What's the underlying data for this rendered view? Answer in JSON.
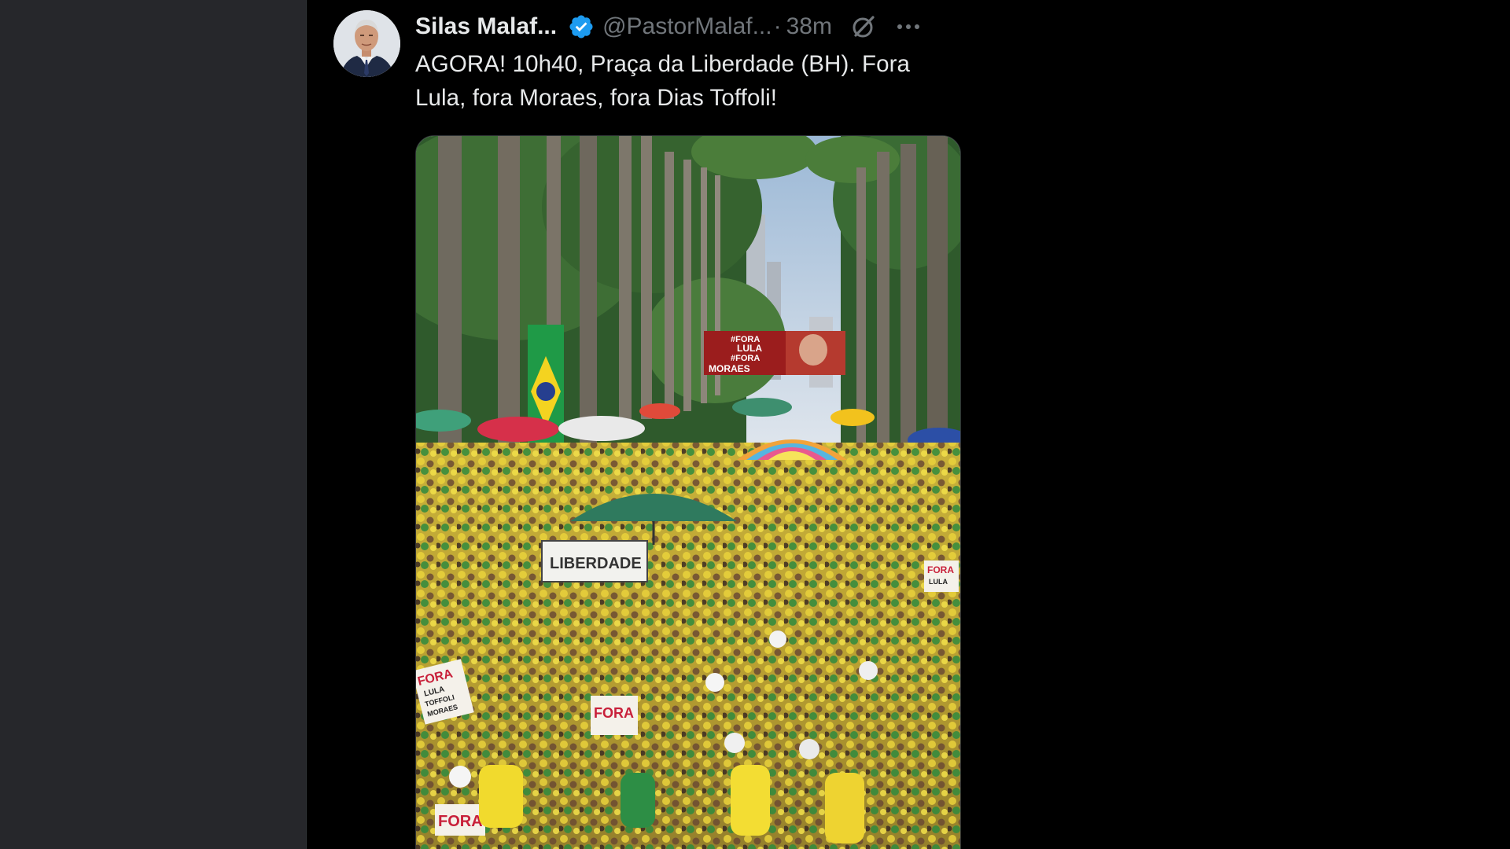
{
  "tweet": {
    "display_name": "Silas Malaf...",
    "handle": "@PastorMalaf...",
    "separator": "·",
    "time": "38m",
    "text": "AGORA! 10h40, Praça da Liberdade (BH). Fora Lula, fora Moraes, fora Dias Toffoli!",
    "icons": {
      "verified": "verified-badge-icon",
      "grok": "grok-icon",
      "more": "more-options-icon"
    },
    "colors": {
      "verified_blue": "#1d9bf0",
      "text_primary": "#e7e9ea",
      "text_secondary": "#71767b"
    }
  },
  "media": {
    "banner_lines": [
      "#FORA",
      "LULA",
      "#FORA",
      "MORAES"
    ],
    "sign_liberdade": "LIBERDADE",
    "sign_left_lines": [
      "FORA",
      "LULA",
      "TOFFOLI",
      "MORAES"
    ],
    "sign_center": "FORA",
    "sign_right_lines": [
      "FORA",
      "LULA"
    ],
    "sign_bottom_left": "FORA"
  }
}
